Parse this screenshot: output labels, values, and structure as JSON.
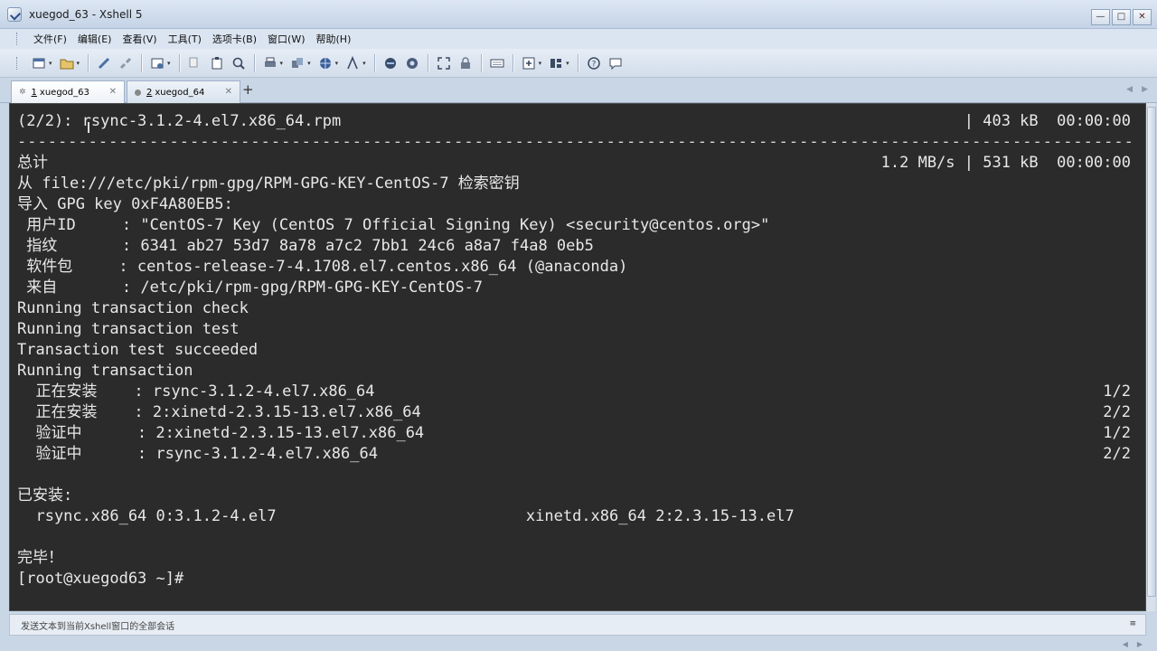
{
  "window": {
    "title": "xuegod_63 - Xshell 5",
    "min_label": "—",
    "max_label": "□",
    "close_label": "✕"
  },
  "menu": [
    "文件(F)",
    "编辑(E)",
    "查看(V)",
    "工具(T)",
    "选项卡(B)",
    "窗口(W)",
    "帮助(H)"
  ],
  "toolbar_icons": [
    "new-session-icon",
    "open-folder-icon",
    "connect-icon",
    "disconnect-icon",
    "new-window-icon",
    "copy-icon",
    "paste-icon",
    "find-icon",
    "print-icon",
    "transfer-icon",
    "globe-icon",
    "font-icon",
    "xftp-icon",
    "xmanager-icon",
    "fullscreen-icon",
    "lock-icon",
    "keyboard-icon",
    "compose-icon",
    "layout-icon",
    "help-icon",
    "chat-icon"
  ],
  "tabs": [
    {
      "number": "1",
      "label": "xuegod_63",
      "active": true
    },
    {
      "number": "2",
      "label": "xuegod_64",
      "active": false
    }
  ],
  "tab_add_label": "+",
  "terminal": {
    "lines": [
      {
        "left": "(2/2): rsync-3.1.2-4.el7.x86_64.rpm",
        "right": "| 403 kB  00:00:00"
      },
      {
        "left": "--------------------------------------------------------------------------------------------------------------",
        "right": "",
        "dash": true
      },
      {
        "left": "总计",
        "right": "1.2 MB/s | 531 kB  00:00:00"
      },
      {
        "left": "从 file:///etc/pki/rpm-gpg/RPM-GPG-KEY-CentOS-7 检索密钥",
        "right": ""
      },
      {
        "left": "导入 GPG key 0xF4A80EB5:",
        "right": ""
      },
      {
        "left": " 用户ID     : \"CentOS-7 Key (CentOS 7 Official Signing Key) <security@centos.org>\"",
        "right": ""
      },
      {
        "left": " 指纹       : 6341 ab27 53d7 8a78 a7c2 7bb1 24c6 a8a7 f4a8 0eb5",
        "right": ""
      },
      {
        "left": " 软件包     : centos-release-7-4.1708.el7.centos.x86_64 (@anaconda)",
        "right": ""
      },
      {
        "left": " 来自       : /etc/pki/rpm-gpg/RPM-GPG-KEY-CentOS-7",
        "right": ""
      },
      {
        "left": "Running transaction check",
        "right": ""
      },
      {
        "left": "Running transaction test",
        "right": ""
      },
      {
        "left": "Transaction test succeeded",
        "right": ""
      },
      {
        "left": "Running transaction",
        "right": ""
      },
      {
        "left": "  正在安装    : rsync-3.1.2-4.el7.x86_64",
        "right": "1/2"
      },
      {
        "left": "  正在安装    : 2:xinetd-2.3.15-13.el7.x86_64",
        "right": "2/2"
      },
      {
        "left": "  验证中      : 2:xinetd-2.3.15-13.el7.x86_64",
        "right": "1/2"
      },
      {
        "left": "  验证中      : rsync-3.1.2-4.el7.x86_64",
        "right": "2/2"
      },
      {
        "left": "",
        "right": ""
      },
      {
        "left": "已安装:",
        "right": ""
      },
      {
        "left": "  rsync.x86_64 0:3.1.2-4.el7                           xinetd.x86_64 2:2.3.15-13.el7",
        "right": ""
      },
      {
        "left": "",
        "right": ""
      },
      {
        "left": "完毕！",
        "right": ""
      },
      {
        "left": "[root@xuegod63 ~]#",
        "right": ""
      }
    ]
  },
  "statusbar": {
    "compose_text": "发送文本到当前Xshell窗口的全部会话",
    "menu_label": "≡"
  }
}
